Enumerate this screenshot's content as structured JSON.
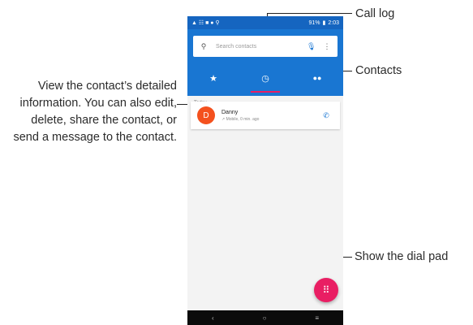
{
  "status_bar": {
    "left_icons": "▲ ☷ ■ ● ⚲",
    "battery": "91%",
    "time": "2:03"
  },
  "search": {
    "placeholder": "Search contacts",
    "icon": "search-icon",
    "mic_icon": "mic-icon",
    "menu_icon": "more-vert-icon"
  },
  "tabs": [
    {
      "name": "favorites",
      "icon": "★",
      "icon_name": "star-icon"
    },
    {
      "name": "recents",
      "icon": "◷",
      "icon_name": "clock-icon",
      "active": true
    },
    {
      "name": "contacts",
      "icon": "👥",
      "icon_name": "people-icon"
    }
  ],
  "list": {
    "section_label": "Today",
    "items": [
      {
        "initial": "D",
        "name": "Danny",
        "detail": "↗ Mobile, 0 min. ago"
      }
    ]
  },
  "fab": {
    "icon": "⠿",
    "icon_name": "dialpad-icon"
  },
  "navbar": {
    "back": "‹",
    "home": "○",
    "recents": "≡"
  },
  "callouts": {
    "description": "View the contact’s detailed information. You can also edit, delete, share the contact, or send a message to the contact.",
    "call_log": "Call log",
    "contacts": "Contacts",
    "dial_pad": "Show the dial pad"
  },
  "colors": {
    "status_bar": "#1565c0",
    "app_bar": "#1976d2",
    "accent": "#e91e63",
    "avatar": "#f4511e"
  }
}
